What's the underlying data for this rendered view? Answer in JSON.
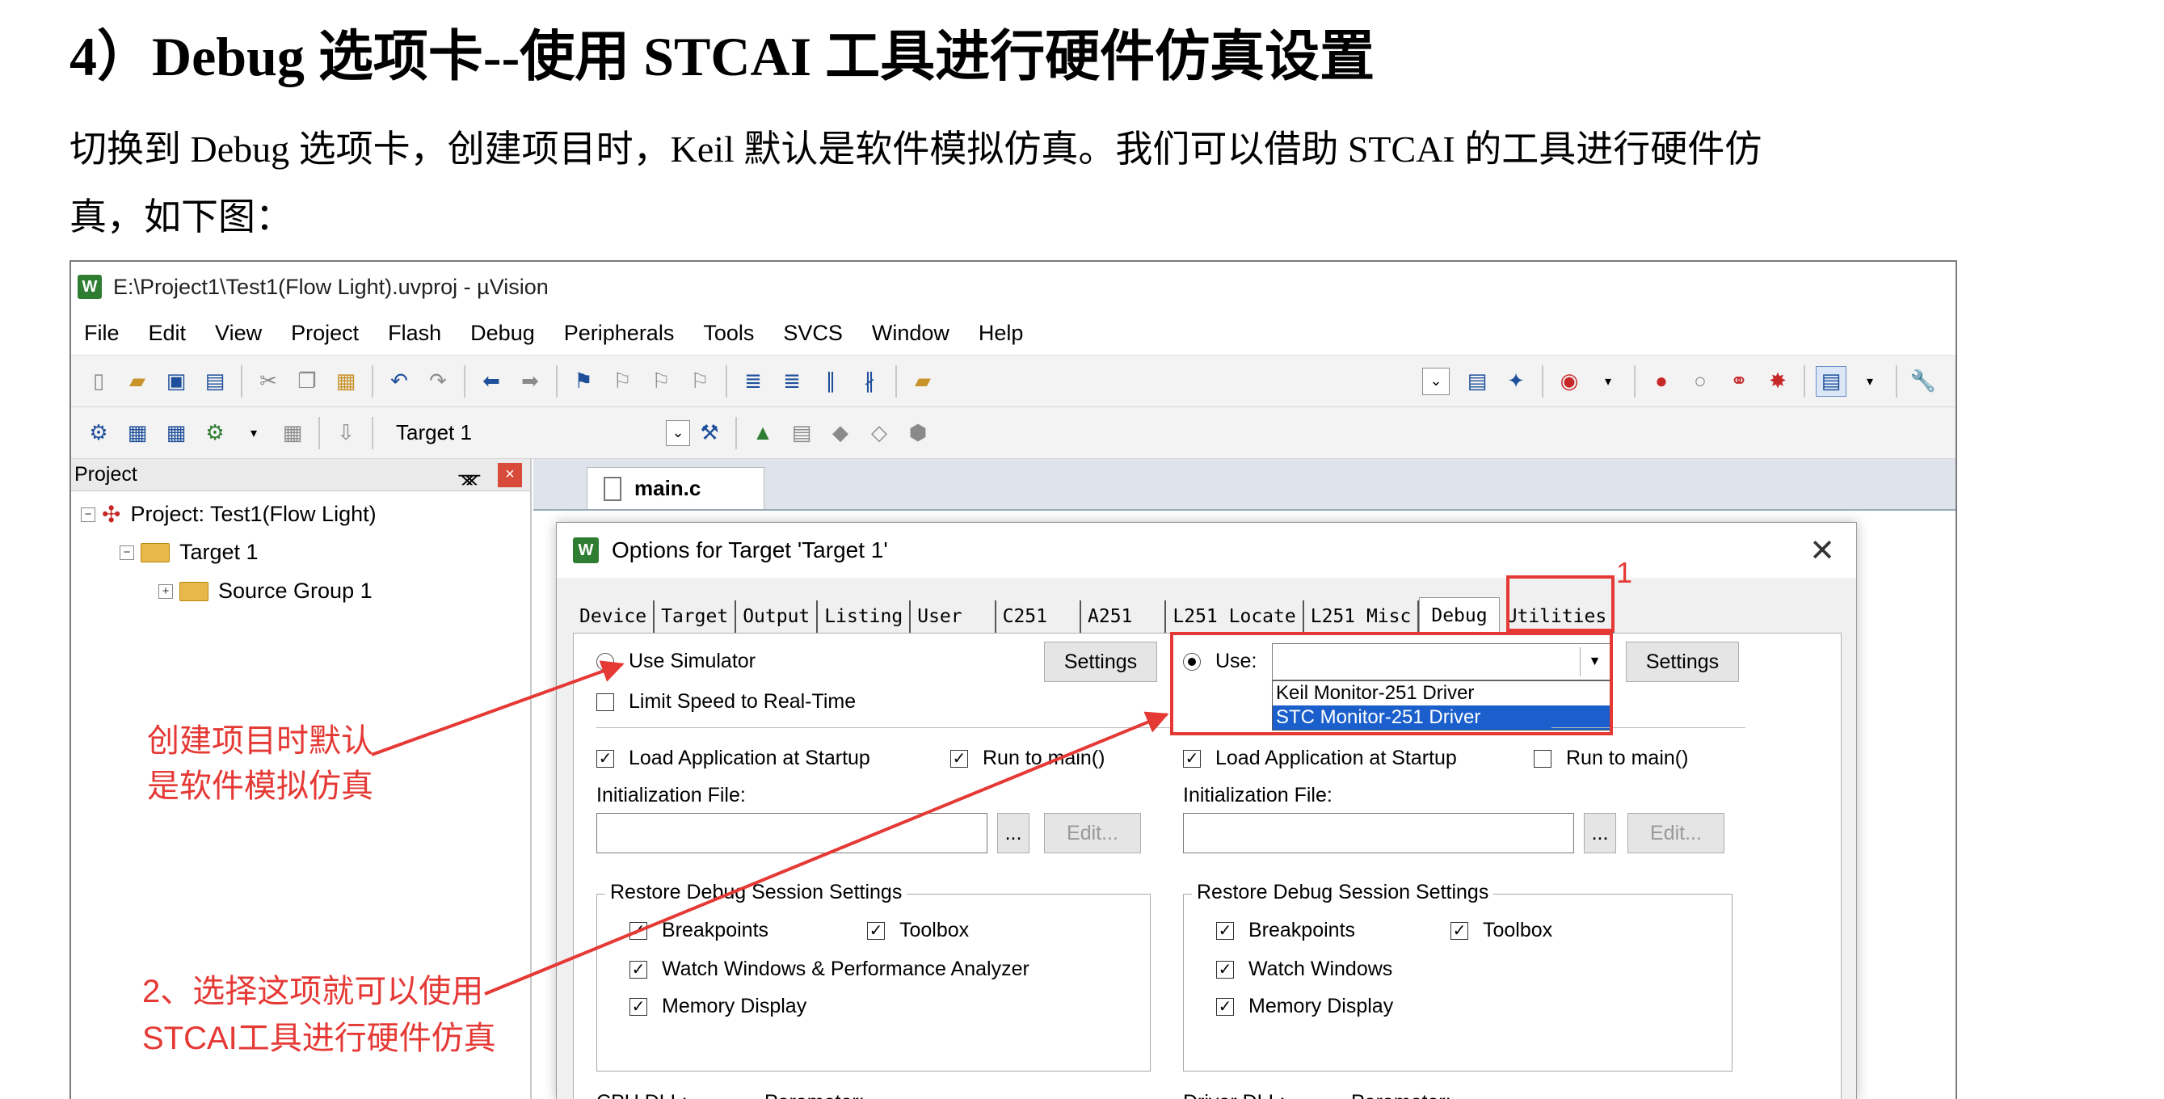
{
  "doc": {
    "heading": "4）Debug 选项卡--使用 STCAI 工具进行硬件仿真设置",
    "para_line1": "切换到 Debug 选项卡，创建项目时，Keil 默认是软件模拟仿真。我们可以借助 STCAI 的工具进行硬件仿",
    "para_line2": "真，如下图："
  },
  "window": {
    "title": "E:\\Project1\\Test1(Flow Light).uvproj - µVision",
    "menu": [
      "File",
      "Edit",
      "View",
      "Project",
      "Flash",
      "Debug",
      "Peripherals",
      "Tools",
      "SVCS",
      "Window",
      "Help"
    ],
    "target": "Target 1"
  },
  "project_panel": {
    "header": "Project",
    "root": "Project: Test1(Flow Light)",
    "target": "Target 1",
    "group": "Source Group 1"
  },
  "editor": {
    "tab": "main.c"
  },
  "dialog": {
    "title": "Options for Target 'Target 1'",
    "tabs": [
      "Device",
      "Target",
      "Output",
      "Listing",
      "User",
      "C251",
      "A251",
      "L251 Locate",
      "L251 Misc",
      "Debug",
      "Utilities"
    ],
    "active_tab": "Debug",
    "left": {
      "use_simulator": "Use Simulator",
      "settings": "Settings",
      "limit_speed": "Limit Speed to Real-Time",
      "load_app": "Load Application at Startup",
      "run_to_main": "Run to main()",
      "init_file": "Initialization File:",
      "browse": "...",
      "edit": "Edit...",
      "restore": "Restore Debug Session Settings",
      "breakpoints": "Breakpoints",
      "toolbox": "Toolbox",
      "watch": "Watch Windows & Performance Analyzer",
      "memory": "Memory Display",
      "dll": "CPU DLL:",
      "param": "Parameter:"
    },
    "right": {
      "use": "Use:",
      "settings": "Settings",
      "options": [
        "Keil Monitor-251 Driver",
        "STC Monitor-251 Driver"
      ],
      "selected_option": "STC Monitor-251 Driver",
      "load_app": "Load Application at Startup",
      "run_to_main": "Run to main()",
      "init_file": "Initialization File:",
      "browse": "...",
      "edit": "Edit...",
      "restore": "Restore Debug Session Settings",
      "breakpoints": "Breakpoints",
      "toolbox": "Toolbox",
      "watch": "Watch Windows",
      "memory": "Memory Display",
      "dll": "Driver DLL:",
      "param": "Parameter:"
    }
  },
  "annotations": {
    "num1": "1",
    "note1_line1": "创建项目时默认",
    "note1_line2": "是软件模拟仿真",
    "note2_line1": "2、选择这项就可以使用",
    "note2_line2": "STCAI工具进行硬件仿真"
  },
  "colors": {
    "annotation_red": "#e53935",
    "selection_blue": "#1a5fcc"
  }
}
